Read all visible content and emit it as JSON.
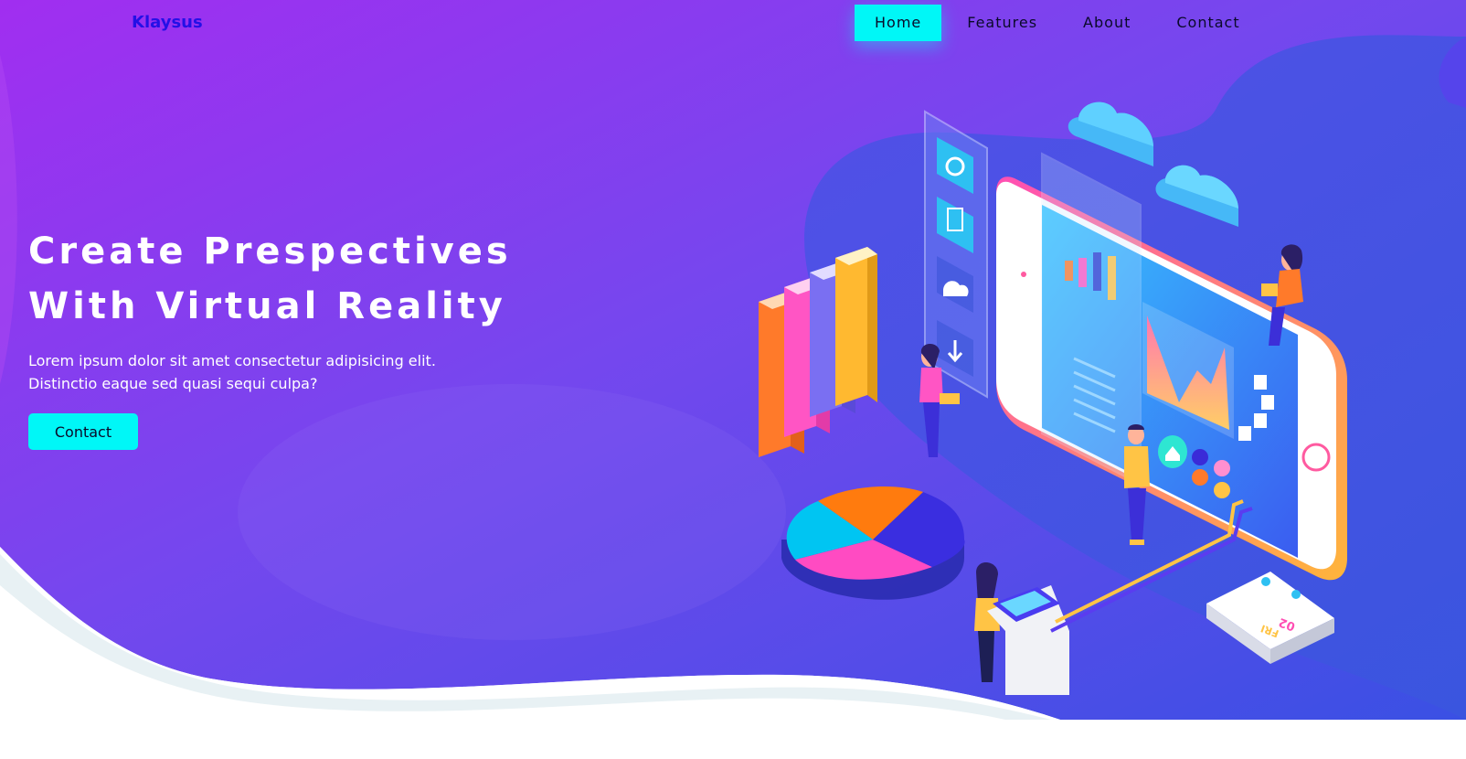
{
  "brand": {
    "name": "Klaysus"
  },
  "nav": {
    "items": [
      {
        "label": "Home",
        "active": true
      },
      {
        "label": "Features",
        "active": false
      },
      {
        "label": "About",
        "active": false
      },
      {
        "label": "Contact",
        "active": false
      }
    ]
  },
  "hero": {
    "headline_line1": "Create Prespectives",
    "headline_line2": "With Virtual Reality",
    "description_line1": "Lorem ipsum dolor sit amet consectetur adipisicing elit.",
    "description_line2": "Distinctio eaque sed quasi sequi culpa?",
    "cta_label": "Contact"
  },
  "illustration": {
    "calendar_day": "FRI",
    "calendar_date": "02"
  },
  "colors": {
    "gradient_start": "#9b2ff0",
    "gradient_end": "#3b4fe6",
    "accent": "#00f7f7",
    "brand": "#2410e6"
  }
}
